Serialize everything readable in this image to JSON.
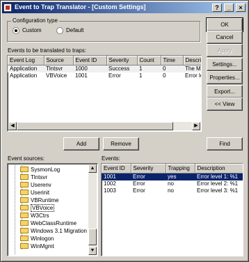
{
  "window": {
    "title": "Event to Trap Translator - [Custom Settings]",
    "controls": {
      "help": "?",
      "minimize": "_",
      "close": "×"
    }
  },
  "config_type": {
    "label": "Configuration type",
    "options": [
      {
        "label": "Custom",
        "selected": true
      },
      {
        "label": "Default",
        "selected": false
      }
    ]
  },
  "translated": {
    "label": "Events to be translated to traps:",
    "columns": [
      "Event Log",
      "Source",
      "Event ID",
      "Severity",
      "Count",
      "Time",
      "Description"
    ],
    "rows": [
      {
        "event_log": "Application",
        "source": "Tlntsvr",
        "event_id": "1000",
        "severity": "Success",
        "count": "1",
        "time": "0",
        "description": "The MS T"
      },
      {
        "event_log": "Application",
        "source": "VBVoice",
        "event_id": "1001",
        "severity": "Error",
        "count": "1",
        "time": "0",
        "description": "Error level"
      }
    ]
  },
  "buttons": {
    "ok": "OK",
    "cancel": "Cancel",
    "apply": "Apply",
    "settings": "Settings...",
    "properties": "Properties...",
    "export": "Export...",
    "view": "<< View",
    "add": "Add",
    "remove": "Remove",
    "find": "Find"
  },
  "sources": {
    "label": "Event sources:",
    "items": [
      "SysmonLog",
      "Tlntsvr",
      "Userenv",
      "Userinit",
      "VBRuntime",
      "VBVoice",
      "W3Ctrs",
      "WebClassRuntime",
      "Windows 3.1 Migration",
      "Winlogon",
      "WinMgmt"
    ],
    "selected": "VBVoice"
  },
  "events": {
    "label": "Events:",
    "columns": [
      "Event ID",
      "Severity",
      "Trapping",
      "Description"
    ],
    "rows": [
      {
        "event_id": "1001",
        "severity": "Error",
        "trapping": "yes",
        "description": "Error level 1: %1"
      },
      {
        "event_id": "1002",
        "severity": "Error",
        "trapping": "no",
        "description": "Error level 2: %1"
      },
      {
        "event_id": "1003",
        "severity": "Error",
        "trapping": "no",
        "description": "Error level 3: %1"
      }
    ]
  },
  "scroll_glyphs": {
    "left": "◀",
    "right": "▶",
    "up": "▲",
    "down": "▼"
  }
}
